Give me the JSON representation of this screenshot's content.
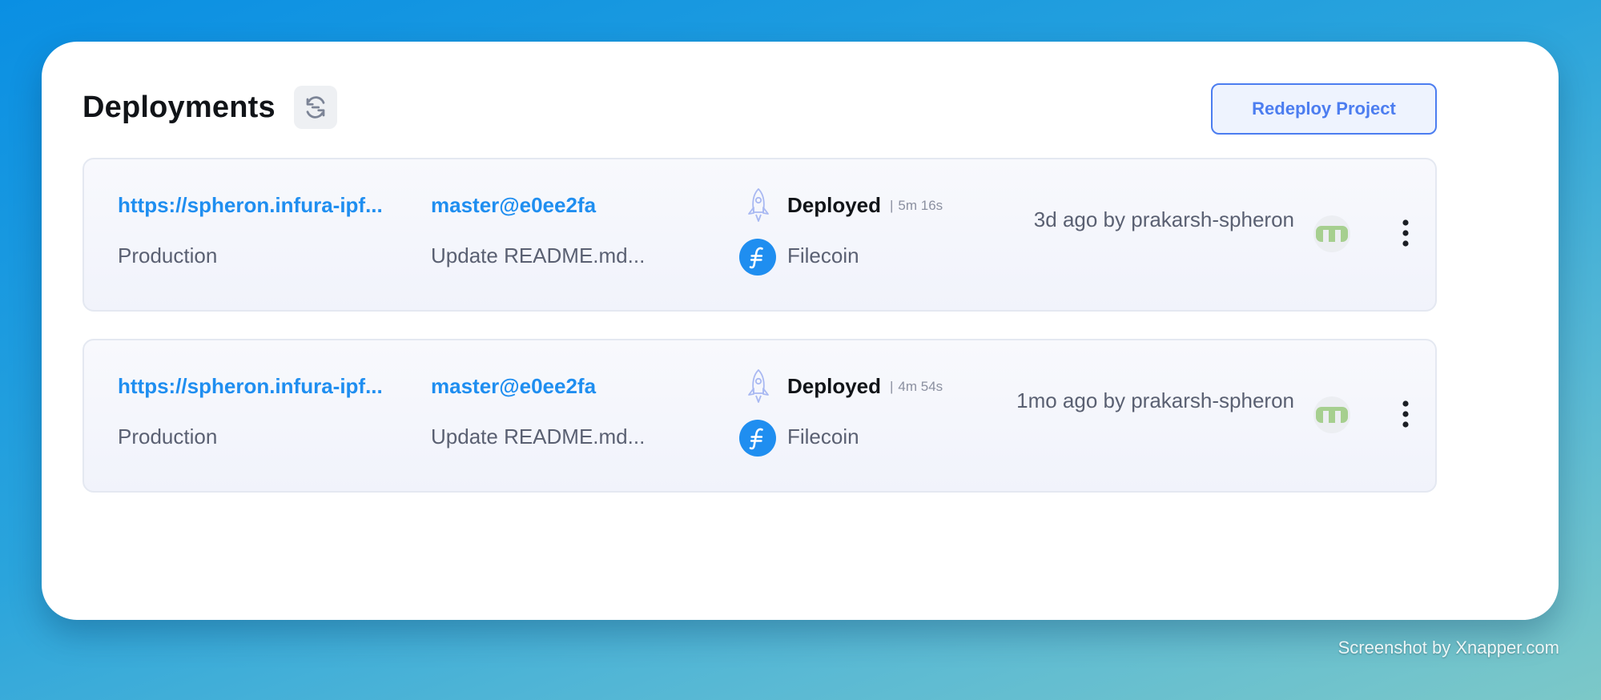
{
  "header": {
    "title": "Deployments",
    "refresh_icon": "refresh-icon",
    "redeploy_label": "Redeploy Project"
  },
  "deployments": [
    {
      "url": "https://spheron.infura-ipf...",
      "environment": "Production",
      "branch": "master@e0ee2fa",
      "commit_message": "Update README.md...",
      "status": "Deployed",
      "duration": "5m 16s",
      "network": "Filecoin",
      "deployed_by": "3d ago by prakarsh-spheron"
    },
    {
      "url": "https://spheron.infura-ipf...",
      "environment": "Production",
      "branch": "master@e0ee2fa",
      "commit_message": "Update README.md...",
      "status": "Deployed",
      "duration": "4m 54s",
      "network": "Filecoin",
      "deployed_by": "1mo ago by prakarsh-spheron"
    }
  ],
  "watermark": "Screenshot by Xnapper.com",
  "colors": {
    "link": "#1f8ef0",
    "accent": "#4c7df0",
    "filecoin": "#1f8ef0",
    "avatar": "#a6cf8f"
  }
}
